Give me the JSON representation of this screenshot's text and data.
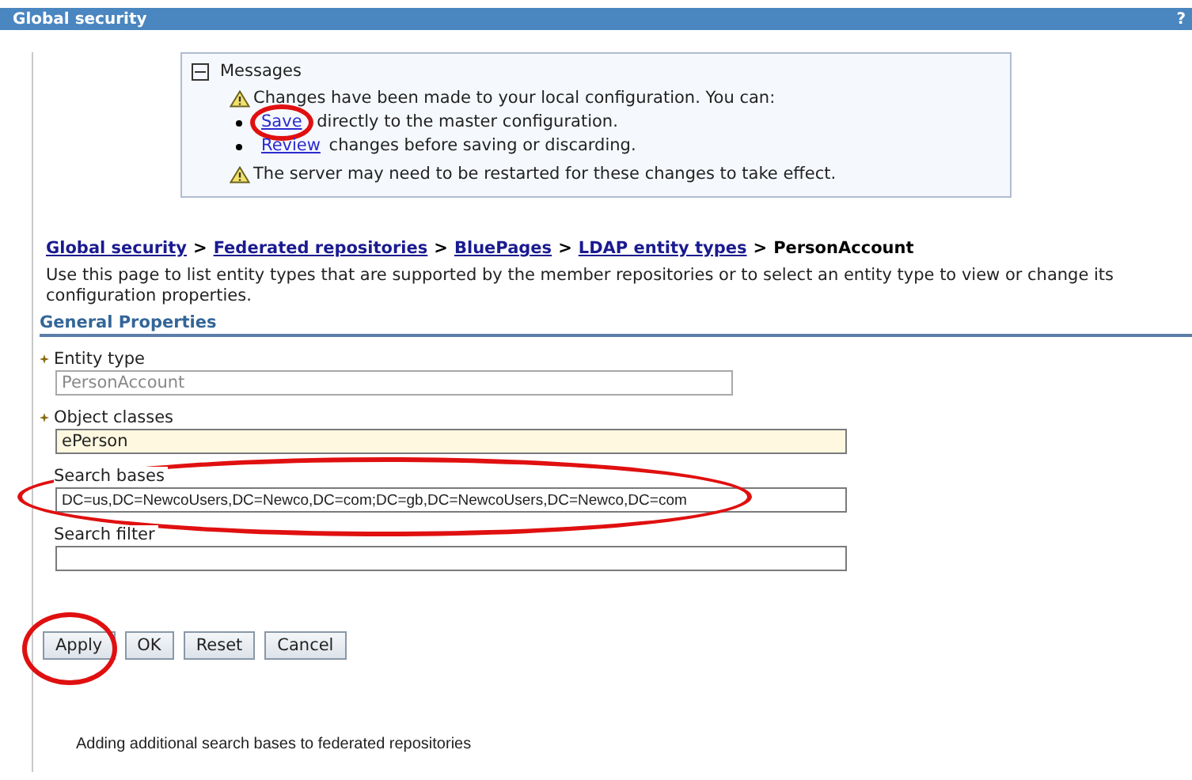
{
  "window": {
    "title": "Global security",
    "help": "?"
  },
  "messages": {
    "title": "Messages",
    "items": [
      {
        "kind": "warning",
        "text": "Changes have been made to your local configuration. You can:"
      },
      {
        "kind": "bullet",
        "link": "Save",
        "text": " directly to the master configuration.",
        "highlight": true
      },
      {
        "kind": "bullet",
        "link": "Review",
        "text": " changes before saving or discarding.",
        "highlight": false
      },
      {
        "kind": "warning",
        "text": "The server may need to be restarted for these changes to take effect."
      }
    ]
  },
  "breadcrumb": {
    "links": [
      "Global security",
      "Federated repositories",
      "BluePages",
      "LDAP entity types"
    ],
    "separator": ">",
    "current": "PersonAccount"
  },
  "description": "Use this page to list entity types that are supported by the member repositories or to select an entity type to view or change its configuration properties.",
  "section": "General Properties",
  "fields": [
    {
      "label": "Entity type",
      "required": true,
      "value": "PersonAccount",
      "disabled": true,
      "highlight": false
    },
    {
      "label": "Object classes",
      "required": true,
      "value": "ePerson",
      "disabled": false,
      "highlight": false
    },
    {
      "label": "Search bases",
      "required": false,
      "value": "DC=us,DC=NewcoUsers,DC=Newco,DC=com;DC=gb,DC=NewcoUsers,DC=Newco,DC=com",
      "disabled": false,
      "highlight": true
    },
    {
      "label": "Search filter",
      "required": false,
      "disabled": false,
      "highlight": false
    }
  ],
  "buttons": [
    {
      "label": "Apply",
      "highlight": true
    },
    {
      "label": "OK",
      "highlight": false
    },
    {
      "label": "Reset",
      "highlight": false
    },
    {
      "label": "Cancel",
      "highlight": false
    }
  ],
  "caption": "Adding additional search bases to federated repositories"
}
